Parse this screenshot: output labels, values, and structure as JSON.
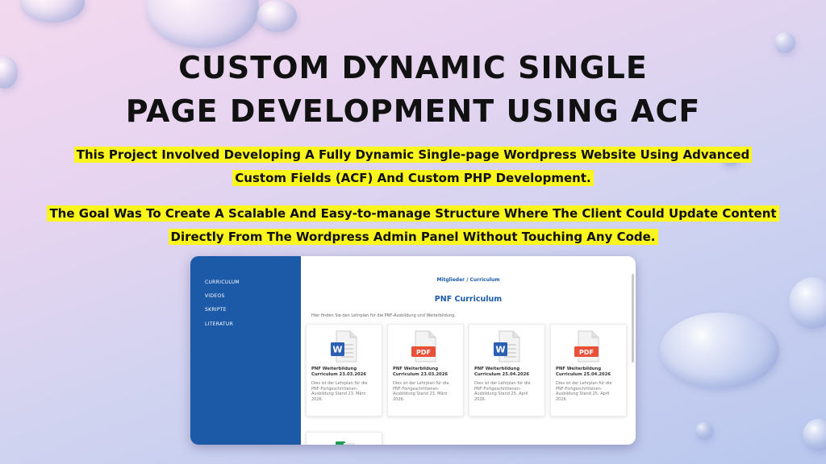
{
  "slide": {
    "title_line1": "CUSTOM DYNAMIC SINGLE",
    "title_line2": "PAGE DEVELOPMENT USING ACF",
    "para1_line1": "This Project Involved Developing A Fully Dynamic Single-page Wordpress Website Using Advanced",
    "para1_line2": "Custom Fields (ACF) And Custom PHP Development.",
    "para2_line1": "The Goal Was To Create A Scalable And Easy-to-manage Structure Where The Client Could Update Content",
    "para2_line2": "Directly From The Wordpress Admin Panel Without Touching Any Code.",
    "highlight_color": "#fbf51e"
  },
  "app": {
    "sidebar": {
      "color": "#1c5aa8",
      "items": [
        {
          "label": "CURRICULUM"
        },
        {
          "label": "VIDEOS"
        },
        {
          "label": "SKRIPTE"
        },
        {
          "label": "LITERATUR"
        }
      ]
    },
    "breadcrumb": "Mitglieder / Curriculum",
    "page_title": "PNF Curriculum",
    "intro": "Hier finden Sie den Lehrplan für die PNF-Ausbildung und Weiterbildung.",
    "cards": [
      {
        "icon": "word-file-icon",
        "badge": "W",
        "title": "PNF Weiterbildung Curriculum 23.03.2026",
        "desc": "Dies ist der Lehrplan für die PNF-Fortgeschrittenen-Ausbildung Stand 23. März 2026."
      },
      {
        "icon": "pdf-file-icon",
        "badge": "PDF",
        "title": "PNF Weiterbildung Curriculum 23.03.2026",
        "desc": "Dies ist der Lehrplan für die PNF-Fortgeschrittenen-Ausbildung Stand 23. März 2026."
      },
      {
        "icon": "word-file-icon",
        "badge": "W",
        "title": "PNF Weiterbildung Curriculum 25.04.2026",
        "desc": "Dies ist der Lehrplan für die PNF-Fortgeschrittenen-Ausbildung Stand 25. April 2026."
      },
      {
        "icon": "pdf-file-icon",
        "badge": "PDF",
        "title": "PNF Weiterbildung Curriculum 25.04.2026",
        "desc": "Dies ist der Lehrplan für die PNF-Fortgeschrittenen-Ausbildung Stand 25. April 2026."
      }
    ],
    "colors": {
      "word": "#2b5fb4",
      "pdf": "#e8503a",
      "excel": "#1f9d55"
    }
  }
}
